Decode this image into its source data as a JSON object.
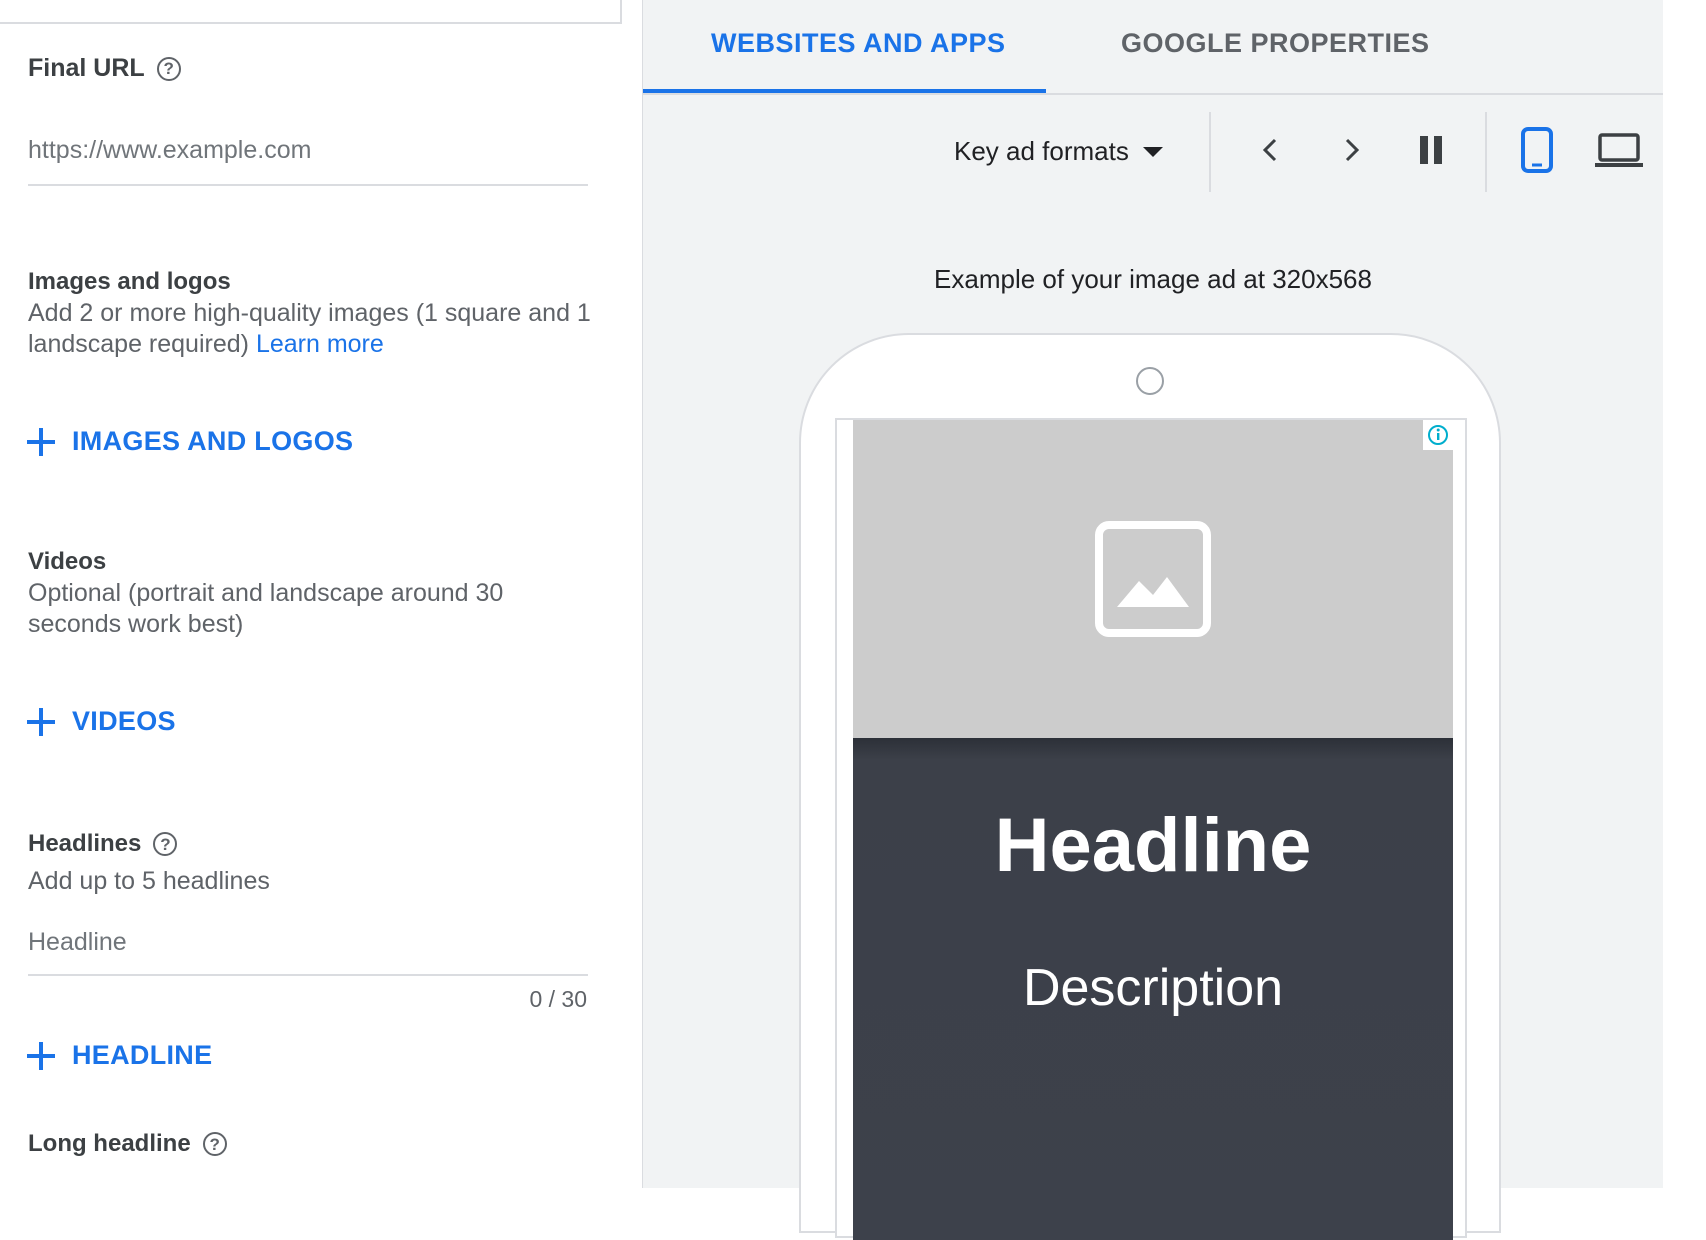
{
  "form": {
    "final_url": {
      "label": "Final URL",
      "placeholder": "https://www.example.com"
    },
    "images": {
      "title": "Images and logos",
      "helper": "Add 2 or more high-quality images (1 square and 1 landscape required)",
      "learn_more": "Learn more",
      "add_label": "IMAGES AND LOGOS"
    },
    "videos": {
      "title": "Videos",
      "helper": "Optional (portrait and landscape around 30 seconds work best)",
      "add_label": "VIDEOS"
    },
    "headlines": {
      "title": "Headlines",
      "helper": "Add up to 5 headlines",
      "placeholder": "Headline",
      "counter": "0 / 30",
      "add_label": "HEADLINE"
    },
    "long_headline": {
      "title": "Long headline"
    }
  },
  "preview": {
    "tabs": [
      {
        "label": "WEBSITES AND APPS",
        "active": true
      },
      {
        "label": "GOOGLE PROPERTIES",
        "active": false
      }
    ],
    "toolbar": {
      "format_select": "Key ad formats",
      "icons": [
        "chevron-left-icon",
        "chevron-right-icon",
        "pause-icon",
        "mobile-icon",
        "laptop-icon"
      ],
      "selected_device": "mobile"
    },
    "caption": "Example of your image ad at 320x568",
    "ad": {
      "headline": "Headline",
      "description": "Description"
    }
  },
  "colors": {
    "accent": "#1a73e8",
    "preview_bg": "#f1f3f4",
    "ad_image_bg": "#cccccc",
    "ad_dark_bg": "#3d414b"
  }
}
